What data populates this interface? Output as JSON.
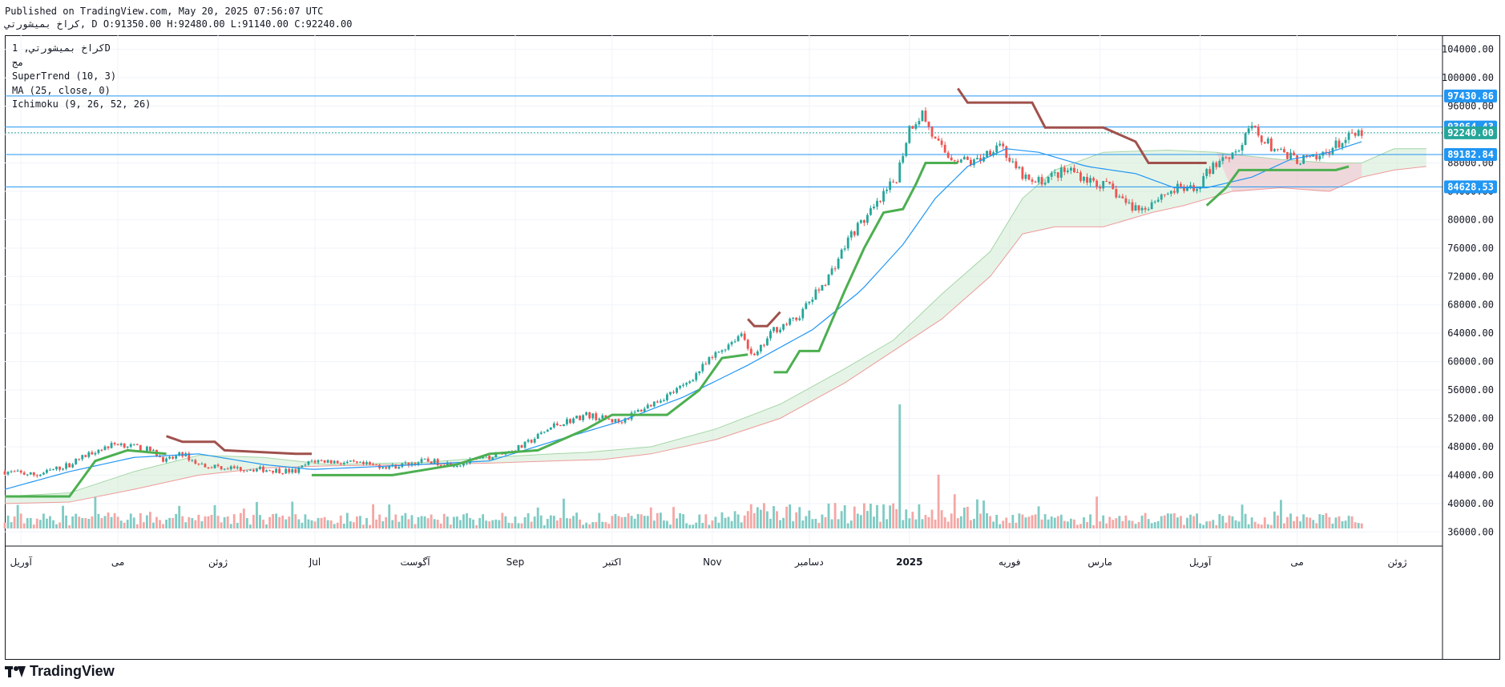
{
  "header": {
    "line1": "Published on TradingView.com, May 20, 2025 07:56:07 UTC",
    "line2": "كراخ بميشورتي, D O:91350.00 H:92480.00 L:91140.00 C:92240.00"
  },
  "legend": {
    "symbol": "كراخ بميشورتي, 1D",
    "exchange": "مج",
    "supertrend": "SuperTrend (10, 3)",
    "ma": "MA (25, close, 0)",
    "ichimoku": "Ichimoku (9, 26, 52, 26)"
  },
  "footer": {
    "brand": "TradingView"
  },
  "colors": {
    "up": "#26a69a",
    "down": "#ef5350",
    "hline": "#2196f3",
    "supertrend_up": "#4caf50",
    "supertrend_down": "#a0514d",
    "ma": "#2196f3",
    "cloud_bull": "#c8e6c9",
    "cloud_bear": "#f8bbd0",
    "vol_up": "#80cbc4",
    "vol_down": "#f4a7a5"
  },
  "chart_data": {
    "type": "candlestick",
    "ylim": [
      34000,
      106000
    ],
    "y_ticks": [
      "104000.00",
      "100000.00",
      "96000.00",
      "92000.00",
      "88000.00",
      "84000.00",
      "80000.00",
      "76000.00",
      "72000.00",
      "68000.00",
      "64000.00",
      "60000.00",
      "56000.00",
      "52000.00",
      "48000.00",
      "44000.00",
      "40000.00",
      "36000.00"
    ],
    "x_labels": [
      {
        "label": "آوریل",
        "t": 5
      },
      {
        "label": "می",
        "t": 35
      },
      {
        "label": "ژوئن",
        "t": 66
      },
      {
        "label": "Jul",
        "t": 96
      },
      {
        "label": "آگوست",
        "t": 127
      },
      {
        "label": "Sep",
        "t": 158
      },
      {
        "label": "اکتبر",
        "t": 188
      },
      {
        "label": "Nov",
        "t": 219
      },
      {
        "label": "دسامبر",
        "t": 249
      },
      {
        "label": "2025",
        "t": 280
      },
      {
        "label": "فوریه",
        "t": 311
      },
      {
        "label": "مارس",
        "t": 339
      },
      {
        "label": "آوریل",
        "t": 370
      },
      {
        "label": "می",
        "t": 400
      },
      {
        "label": "ژوئن",
        "t": 431
      }
    ],
    "t_range": [
      0,
      445
    ],
    "horizontal_lines": [
      {
        "value": 97430.86,
        "label": "97430.86",
        "style": "solid"
      },
      {
        "value": 93064.43,
        "label": "93064.43",
        "style": "solid"
      },
      {
        "value": 92240.0,
        "label": "92240.00",
        "style": "dotted",
        "last_price": true
      },
      {
        "value": 89182.84,
        "label": "89182.84",
        "style": "solid"
      },
      {
        "value": 84628.53,
        "label": "84628.53",
        "style": "solid"
      }
    ],
    "close_anchors": [
      [
        0,
        44500
      ],
      [
        10,
        44000
      ],
      [
        20,
        45500
      ],
      [
        28,
        47500
      ],
      [
        35,
        48500
      ],
      [
        45,
        47500
      ],
      [
        50,
        46000
      ],
      [
        55,
        47000
      ],
      [
        60,
        45500
      ],
      [
        70,
        45000
      ],
      [
        80,
        44800
      ],
      [
        90,
        44500
      ],
      [
        95,
        46000
      ],
      [
        100,
        46000
      ],
      [
        110,
        45500
      ],
      [
        120,
        45200
      ],
      [
        130,
        46000
      ],
      [
        140,
        45500
      ],
      [
        150,
        46500
      ],
      [
        160,
        48000
      ],
      [
        170,
        51000
      ],
      [
        180,
        52500
      ],
      [
        190,
        51500
      ],
      [
        200,
        54000
      ],
      [
        210,
        56500
      ],
      [
        220,
        61000
      ],
      [
        228,
        64000
      ],
      [
        232,
        60500
      ],
      [
        238,
        64500
      ],
      [
        245,
        66000
      ],
      [
        255,
        72000
      ],
      [
        262,
        78000
      ],
      [
        270,
        82000
      ],
      [
        276,
        86000
      ],
      [
        280,
        93000
      ],
      [
        284,
        95000
      ],
      [
        288,
        91000
      ],
      [
        292,
        89000
      ],
      [
        300,
        88000
      ],
      [
        308,
        91000
      ],
      [
        312,
        87500
      ],
      [
        318,
        85000
      ],
      [
        326,
        86500
      ],
      [
        330,
        87000
      ],
      [
        336,
        85500
      ],
      [
        342,
        84500
      ],
      [
        348,
        82000
      ],
      [
        352,
        81500
      ],
      [
        358,
        83500
      ],
      [
        364,
        84500
      ],
      [
        368,
        84000
      ],
      [
        372,
        86500
      ],
      [
        376,
        88500
      ],
      [
        382,
        90000
      ],
      [
        386,
        93000
      ],
      [
        390,
        91000
      ],
      [
        396,
        89000
      ],
      [
        400,
        88500
      ],
      [
        406,
        88500
      ],
      [
        410,
        90000
      ],
      [
        416,
        91500
      ],
      [
        420,
        92240
      ]
    ],
    "volume_spike": {
      "t": 277,
      "value_ratio": 1.0
    },
    "supertrend": {
      "up_segments": [
        [
          [
            0,
            41000
          ],
          [
            20,
            41000
          ],
          [
            28,
            46000
          ],
          [
            38,
            47500
          ],
          [
            50,
            47000
          ]
        ],
        [
          [
            95,
            44000
          ],
          [
            120,
            44000
          ],
          [
            140,
            45500
          ],
          [
            150,
            47000
          ],
          [
            165,
            47500
          ],
          [
            180,
            50500
          ],
          [
            188,
            52500
          ],
          [
            205,
            52500
          ],
          [
            215,
            56000
          ],
          [
            222,
            60500
          ],
          [
            230,
            61000
          ]
        ],
        [
          [
            238,
            58500
          ],
          [
            242,
            58500
          ],
          [
            246,
            61500
          ],
          [
            252,
            61500
          ],
          [
            260,
            70000
          ],
          [
            266,
            76000
          ],
          [
            272,
            81000
          ],
          [
            278,
            81500
          ],
          [
            282,
            85000
          ],
          [
            285,
            88000
          ],
          [
            295,
            88000
          ]
        ],
        [
          [
            372,
            82000
          ],
          [
            378,
            84500
          ],
          [
            382,
            87000
          ],
          [
            396,
            87000
          ],
          [
            412,
            87000
          ],
          [
            416,
            87500
          ]
        ]
      ],
      "down_segments": [
        [
          [
            50,
            49500
          ],
          [
            55,
            48700
          ],
          [
            65,
            48700
          ],
          [
            68,
            47500
          ],
          [
            90,
            47000
          ],
          [
            95,
            47000
          ]
        ],
        [
          [
            230,
            66000
          ],
          [
            232,
            65000
          ],
          [
            236,
            65000
          ],
          [
            240,
            67000
          ]
        ],
        [
          [
            295,
            98500
          ],
          [
            298,
            96500
          ],
          [
            318,
            96500
          ],
          [
            322,
            93000
          ],
          [
            340,
            93000
          ],
          [
            350,
            91000
          ],
          [
            354,
            88000
          ],
          [
            372,
            88000
          ]
        ]
      ]
    },
    "ma_anchors": [
      [
        0,
        42000
      ],
      [
        20,
        44500
      ],
      [
        40,
        46500
      ],
      [
        60,
        47000
      ],
      [
        80,
        45500
      ],
      [
        95,
        44800
      ],
      [
        120,
        45300
      ],
      [
        150,
        46000
      ],
      [
        170,
        48800
      ],
      [
        190,
        51500
      ],
      [
        210,
        55000
      ],
      [
        230,
        59500
      ],
      [
        250,
        64500
      ],
      [
        265,
        70000
      ],
      [
        278,
        76500
      ],
      [
        288,
        83000
      ],
      [
        298,
        87500
      ],
      [
        310,
        90000
      ],
      [
        320,
        89500
      ],
      [
        335,
        87500
      ],
      [
        350,
        86500
      ],
      [
        362,
        84500
      ],
      [
        372,
        84500
      ],
      [
        386,
        86000
      ],
      [
        398,
        88500
      ],
      [
        410,
        89500
      ],
      [
        420,
        91000
      ]
    ],
    "cloud": {
      "upper": [
        [
          0,
          41000
        ],
        [
          20,
          41500
        ],
        [
          40,
          44500
        ],
        [
          60,
          46800
        ],
        [
          80,
          46500
        ],
        [
          100,
          45500
        ],
        [
          130,
          45800
        ],
        [
          150,
          46500
        ],
        [
          170,
          47000
        ],
        [
          180,
          47200
        ],
        [
          200,
          48000
        ],
        [
          220,
          50500
        ],
        [
          240,
          54000
        ],
        [
          260,
          59000
        ],
        [
          275,
          63000
        ],
        [
          290,
          69500
        ],
        [
          305,
          75500
        ],
        [
          315,
          83000
        ],
        [
          325,
          87000
        ],
        [
          340,
          89500
        ],
        [
          360,
          89800
        ],
        [
          375,
          89500
        ],
        [
          380,
          89200
        ],
        [
          395,
          88500
        ],
        [
          410,
          88000
        ],
        [
          420,
          88000
        ],
        [
          430,
          90000
        ],
        [
          440,
          90000
        ]
      ],
      "lower": [
        [
          0,
          40000
        ],
        [
          20,
          40200
        ],
        [
          40,
          42000
        ],
        [
          60,
          44000
        ],
        [
          80,
          45000
        ],
        [
          100,
          45300
        ],
        [
          130,
          45500
        ],
        [
          150,
          45700
        ],
        [
          170,
          46000
        ],
        [
          185,
          46200
        ],
        [
          200,
          47000
        ],
        [
          220,
          49000
        ],
        [
          240,
          52000
        ],
        [
          260,
          57000
        ],
        [
          275,
          61500
        ],
        [
          290,
          66000
        ],
        [
          305,
          72000
        ],
        [
          315,
          78000
        ],
        [
          325,
          79000
        ],
        [
          340,
          79000
        ],
        [
          355,
          81000
        ],
        [
          365,
          82000
        ],
        [
          380,
          84000
        ],
        [
          395,
          84500
        ],
        [
          410,
          84000
        ],
        [
          420,
          86000
        ],
        [
          430,
          87000
        ],
        [
          440,
          87500
        ]
      ]
    }
  }
}
